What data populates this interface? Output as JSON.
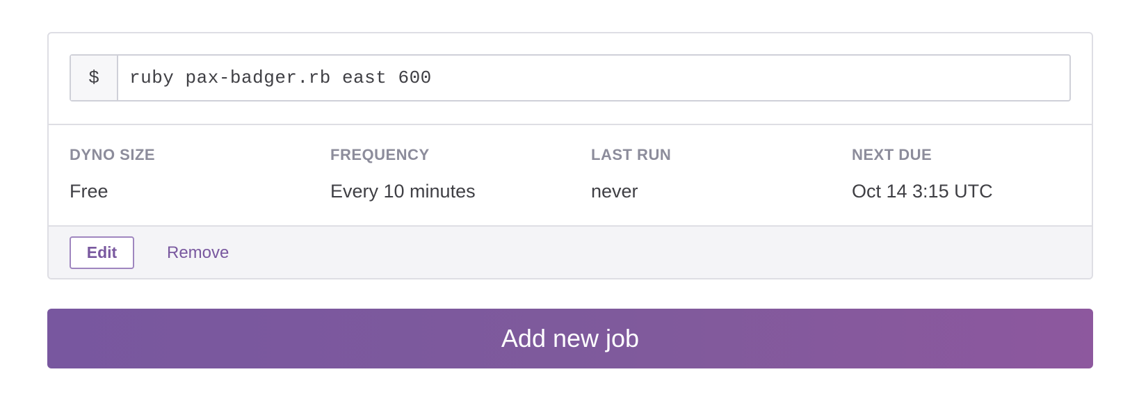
{
  "job": {
    "command": {
      "prompt_symbol": "$",
      "value": "ruby pax-badger.rb east 600"
    },
    "details": [
      {
        "label": "DYNO SIZE",
        "value": "Free"
      },
      {
        "label": "FREQUENCY",
        "value": "Every 10 minutes"
      },
      {
        "label": "LAST RUN",
        "value": "never"
      },
      {
        "label": "NEXT DUE",
        "value": "Oct 14 3:15 UTC"
      }
    ],
    "actions": {
      "edit_label": "Edit",
      "remove_label": "Remove"
    }
  },
  "add_job": {
    "label": "Add new job"
  },
  "colors": {
    "accent": "#79589f",
    "label_gray": "#8c8c9b",
    "text": "#3f3f44",
    "border": "#dedee4",
    "actions_bg": "#f4f4f7"
  }
}
